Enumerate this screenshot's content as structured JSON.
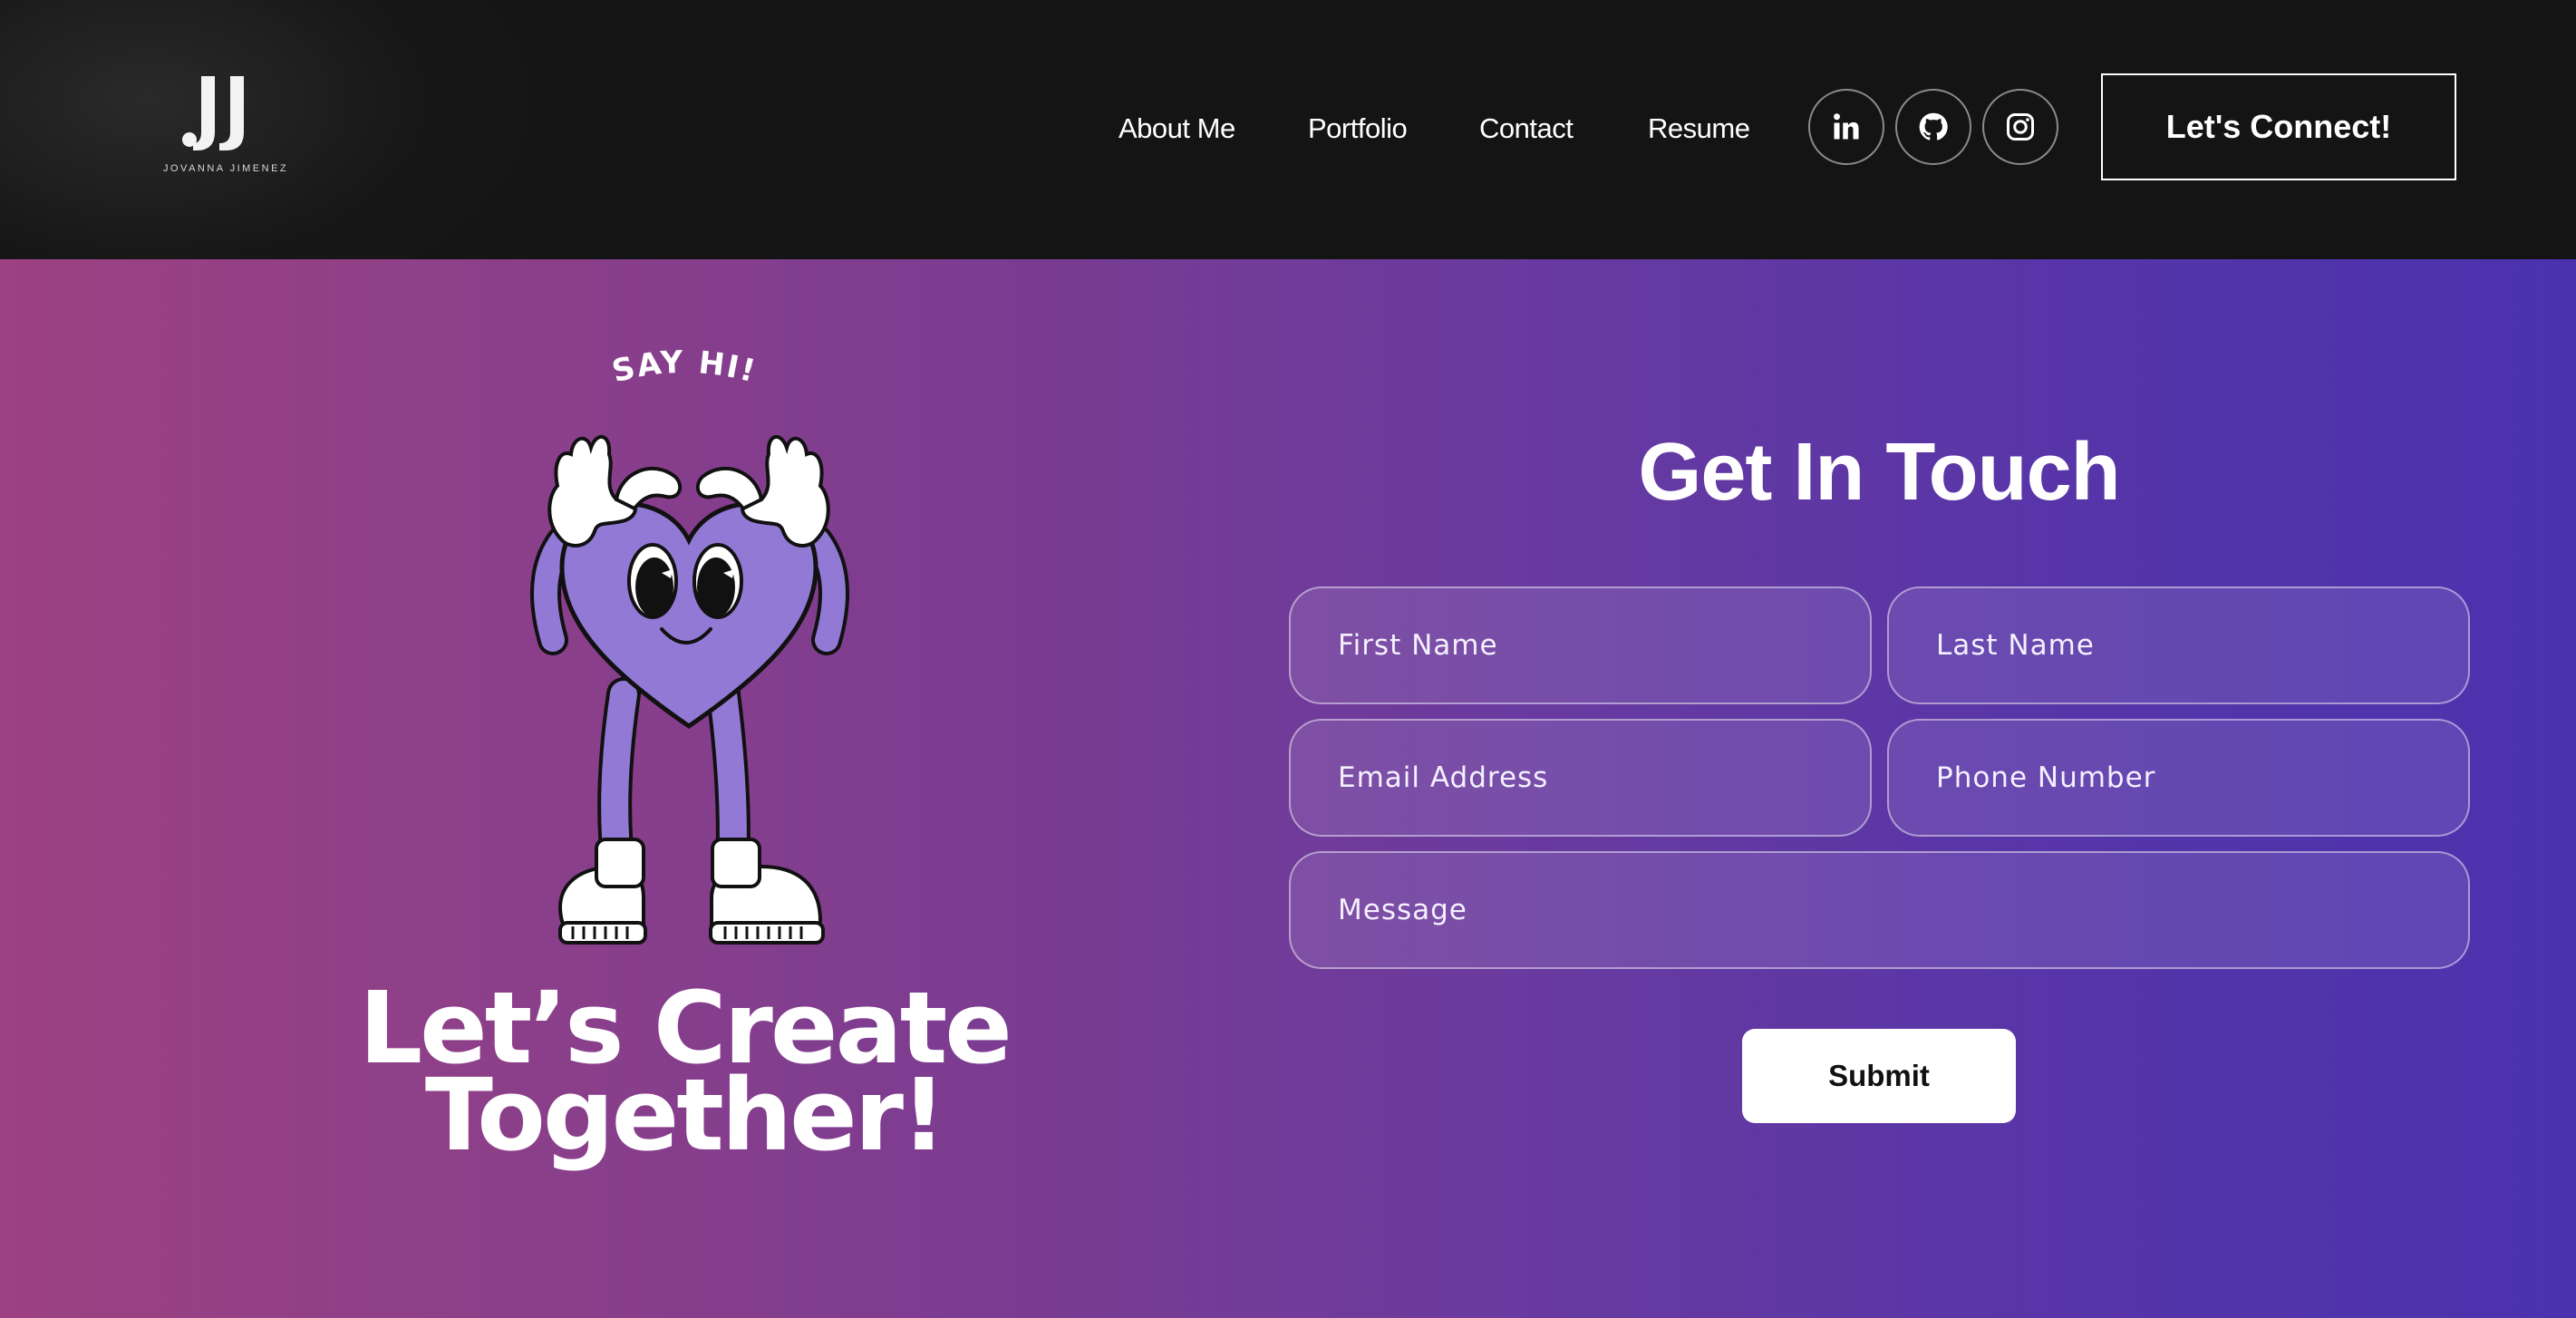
{
  "brand": {
    "monogram": "JJ",
    "name": "JOVANNA JIMENEZ"
  },
  "nav": {
    "items": [
      {
        "label": "About Me"
      },
      {
        "label": "Portfolio"
      },
      {
        "label": "Contact"
      },
      {
        "label": "Resume"
      }
    ]
  },
  "social": [
    {
      "icon": "linkedin-icon"
    },
    {
      "icon": "github-icon"
    },
    {
      "icon": "instagram-icon"
    }
  ],
  "header": {
    "cta_label": "Let's Connect!"
  },
  "hero": {
    "say_hi": "SAY HI!",
    "headline_line1": "Let’s Create",
    "headline_line2": "Together!"
  },
  "form": {
    "title": "Get In Touch",
    "first_name_placeholder": "First Name",
    "last_name_placeholder": "Last Name",
    "email_placeholder": "Email Address",
    "phone_placeholder": "Phone Number",
    "message_placeholder": "Message",
    "submit_label": "Submit"
  },
  "colors": {
    "header_bg": "#141414",
    "gradient_start": "#9c4182",
    "gradient_end": "#4a32ae",
    "mascot_body": "#9379d6",
    "text": "#ffffff"
  }
}
